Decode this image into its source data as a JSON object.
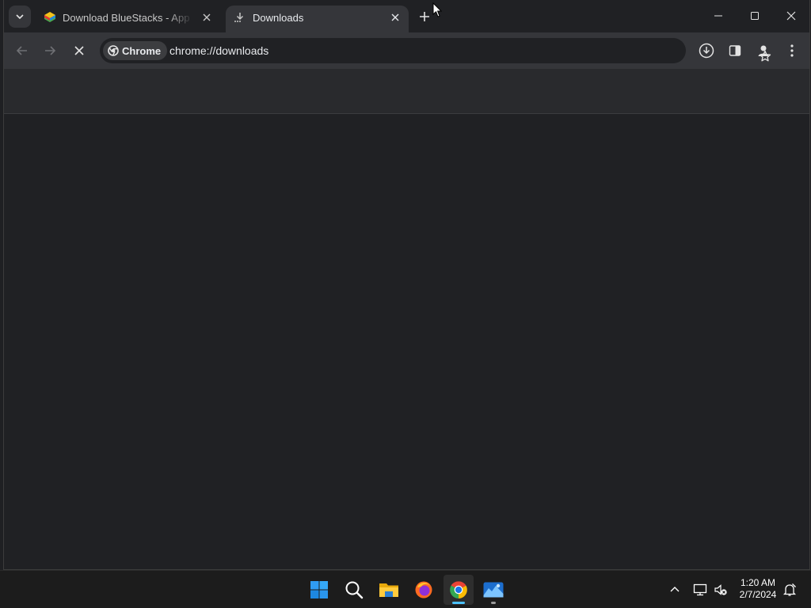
{
  "tabs": [
    {
      "title": "Download BlueStacks - App Pla",
      "favicon": "bluestacks-icon"
    },
    {
      "title": "Downloads",
      "favicon": "download-icon",
      "active": true
    }
  ],
  "omnibox": {
    "chip_label": "Chrome",
    "url": "chrome://downloads"
  },
  "toolbar": {
    "icons": [
      "back-arrow-icon",
      "forward-arrow-icon",
      "stop-loading-icon",
      "star-icon",
      "download-icon",
      "side-panel-icon",
      "profile-icon",
      "more-vert-icon"
    ]
  },
  "window_controls": [
    "minimize-icon",
    "maximize-icon",
    "close-icon"
  ],
  "taskbar": {
    "apps": [
      "windows-start-icon",
      "search-icon",
      "file-explorer-icon",
      "firefox-icon",
      "chrome-icon",
      "photos-icon"
    ],
    "clock": {
      "time": "1:20 AM",
      "date": "2/7/2024"
    }
  },
  "colors": {
    "accent": "#4cc2ff",
    "toolbar": "#35363a",
    "page": "#202124"
  }
}
